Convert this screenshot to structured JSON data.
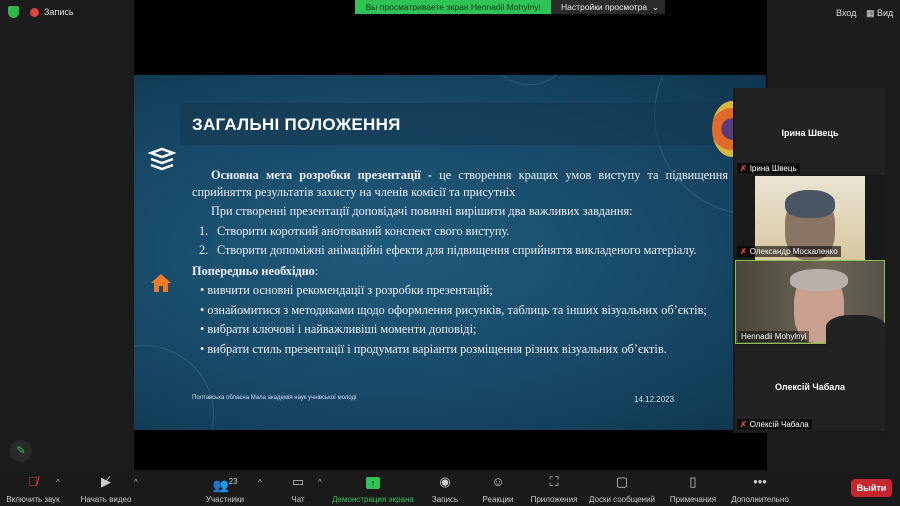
{
  "topbar": {
    "record_label": "Запись",
    "banner": "Вы просматриваете экран Hennadii Mohylnyi",
    "view_options": "Настройки просмотра",
    "enter": "Вход",
    "view": "Вид"
  },
  "slide": {
    "title": "ЗАГАЛЬНІ ПОЛОЖЕННЯ",
    "p1_bold": "Основна мета розробки презентації -",
    "p1_rest": " це створення кращих умов виступу та підвищення сприйняття результатів захисту на членів комісії та присутніх",
    "p2": "При створенні презентації доповідачі повинні вирішити два важливих завдання:",
    "list": [
      {
        "n": "1.",
        "t": "Створити короткий анотований конспект свого виступу."
      },
      {
        "n": "2.",
        "t": "Створити допоміжні анімаційні ефекти для підвищення сприйняття викладеного матеріалу."
      }
    ],
    "pre_bold": "Попередньо необхідно",
    "pre_colon": ":",
    "bullets": [
      "• вивчити основні рекомендації з розробки презентацій;",
      "• ознайомитися з методиками щодо оформлення рисунків, таблиць та інших візуальних об’єктів;",
      "• вибрати ключові і найважливіші моменти доповіді;",
      "• вибрати стиль презентації і продумати варіанти розміщення різних візуальних об’єктів."
    ],
    "footer": "Полтавська обласна Мала академія наук учнівської молоді",
    "date": "14.12.2023"
  },
  "participants": [
    {
      "name": "Ірина Швець"
    },
    {
      "name": "Олександр Москаленко"
    },
    {
      "name": "Hennadii Mohylnyi"
    },
    {
      "name": "Олексій Чабала"
    }
  ],
  "toolbar": {
    "mute": "Включить звук",
    "video": "Начать видео",
    "participants": "Участники",
    "participants_count": "23",
    "chat": "Чат",
    "share": "Демонстрация экрана",
    "record": "Запись",
    "reactions": "Реакции",
    "apps": "Приложения",
    "whiteboards": "Доски сообщений",
    "notes": "Примечания",
    "more": "Дополнительно",
    "leave": "Выйти"
  },
  "colors": {
    "accent": "#2fc257",
    "leave": "#c4262d"
  }
}
